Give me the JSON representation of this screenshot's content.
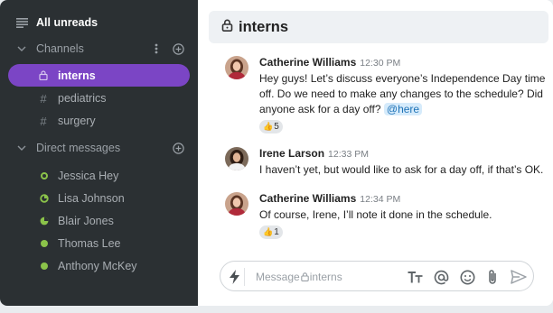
{
  "sidebar": {
    "all_unreads": "All unreads",
    "channels_header": "Channels",
    "channels": [
      {
        "label": "interns",
        "icon": "lock-icon",
        "active": true
      },
      {
        "label": "pediatrics",
        "icon": "hash-icon"
      },
      {
        "label": "surgery",
        "icon": "hash-icon"
      }
    ],
    "dm_header": "Direct messages",
    "direct_messages": [
      {
        "label": "Jessica Hey",
        "status": "away"
      },
      {
        "label": "Lisa Johnson",
        "status": "dnd-partial"
      },
      {
        "label": "Blair Jones",
        "status": "busy"
      },
      {
        "label": "Thomas Lee",
        "status": "online"
      },
      {
        "label": "Anthony McKey",
        "status": "online"
      }
    ]
  },
  "channel": {
    "title": "interns"
  },
  "messages": [
    {
      "author": "Catherine Williams",
      "time": "12:30 PM",
      "text": "Hey guys! Let’s discuss everyone’s Independence Day time off. Do we need to make any changes to the schedule? Did anyone ask for a day off?",
      "mention": "@here",
      "reaction_emoji": "👍",
      "reaction_count": "5"
    },
    {
      "author": "Irene Larson",
      "time": "12:33 PM",
      "text": "I haven’t yet, but would like to ask for a day off, if that’s OK."
    },
    {
      "author": "Catherine Williams",
      "time": "12:34 PM",
      "text": "Of course, Irene, I’ll note it done in the schedule.",
      "reaction_emoji": "👍",
      "reaction_count": "1"
    }
  ],
  "composer": {
    "placeholder_prefix": "Message ",
    "placeholder_channel": "interns"
  },
  "colors": {
    "sidebar_bg": "#2b3033",
    "active_channel": "#7b45c5",
    "presence_green": "#8bc34a",
    "mention_bg": "#d6ebfb"
  }
}
